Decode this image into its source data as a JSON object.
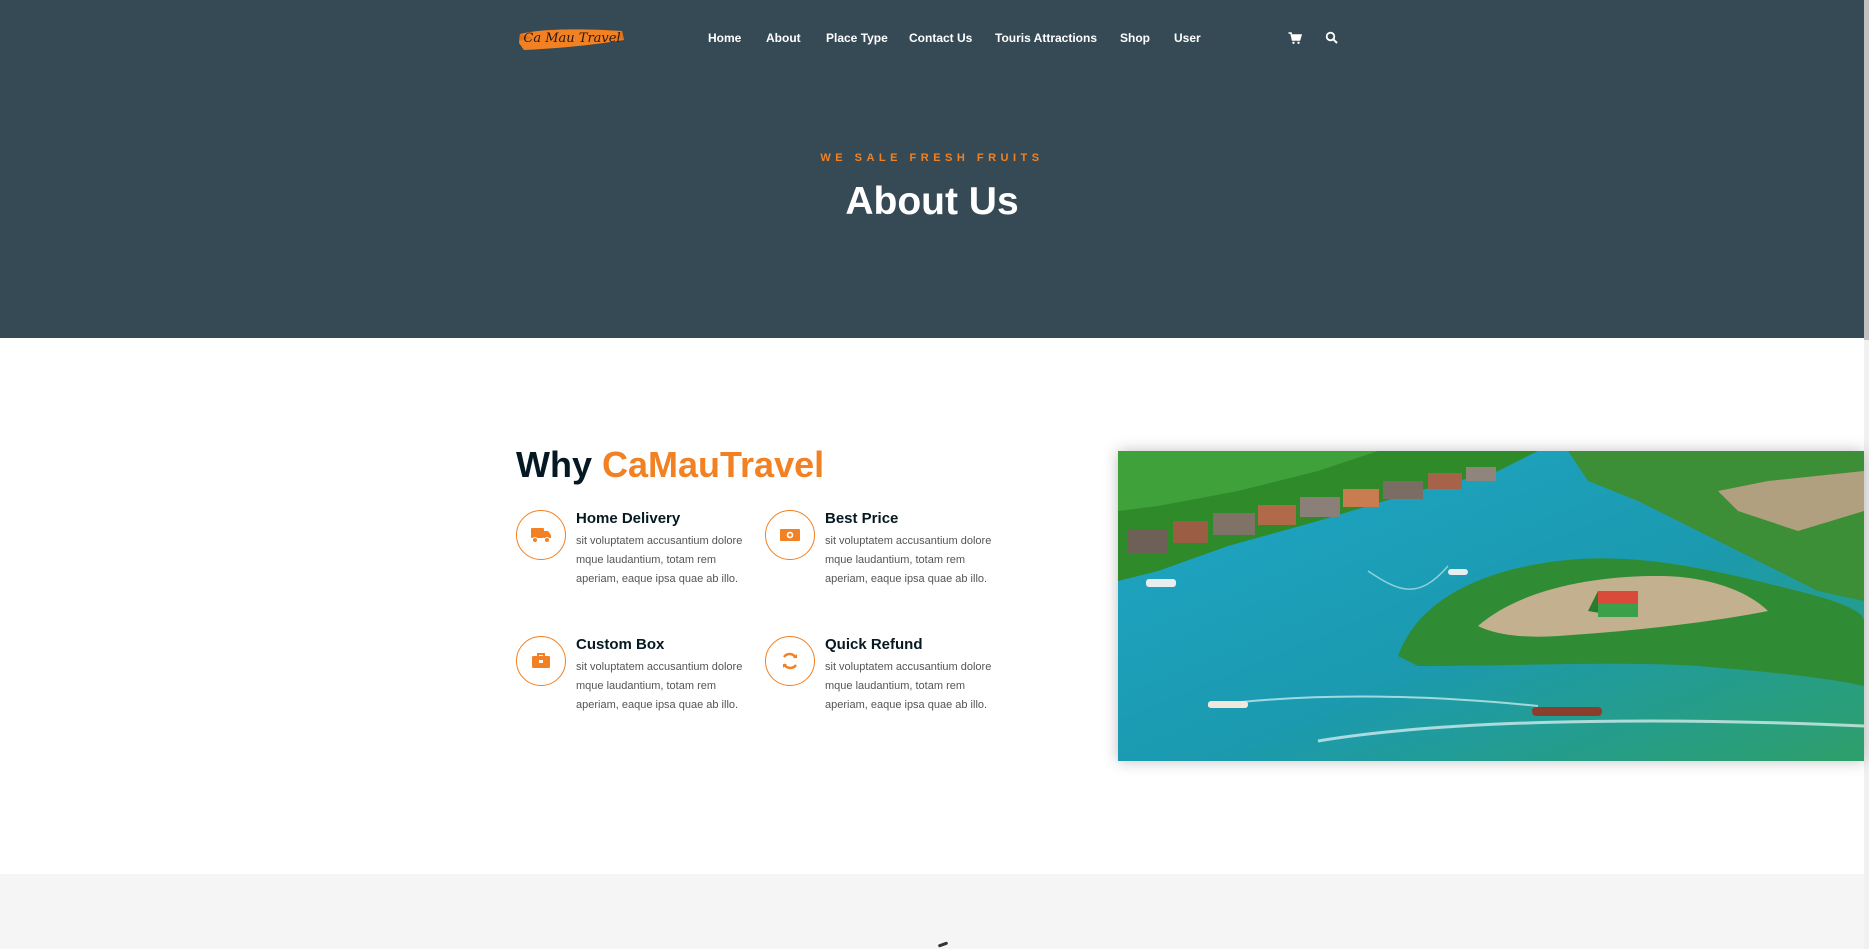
{
  "brand": {
    "logo_text": "Ca Mau Travel",
    "accent": "#f28123",
    "hero_bg": "#364a55"
  },
  "nav": {
    "items": [
      "Home",
      "About",
      "Place Type",
      "Contact Us",
      "Touris Attractions",
      "Shop",
      "User"
    ],
    "cart_icon": "cart-icon",
    "search_icon": "search-icon"
  },
  "hero": {
    "eyebrow": "WE SALE FRESH FRUITS",
    "title": "About Us"
  },
  "why": {
    "title_prefix": "Why",
    "title_accent": "CaMauTravel",
    "features": [
      {
        "icon": "truck-icon",
        "title": "Home Delivery",
        "desc": "sit voluptatem accusantium dolore mque laudantium, totam rem aperiam, eaque ipsa quae ab illo."
      },
      {
        "icon": "money-icon",
        "title": "Best Price",
        "desc": "sit voluptatem accusantium dolore mque laudantium, totam rem aperiam, eaque ipsa quae ab illo."
      },
      {
        "icon": "briefcase-icon",
        "title": "Custom Box",
        "desc": "sit voluptatem accusantium dolore mque laudantium, totam rem aperiam, eaque ipsa quae ab illo."
      },
      {
        "icon": "refresh-icon",
        "title": "Quick Refund",
        "desc": "sit voluptatem accusantium dolore mque laudantium, totam rem aperiam, eaque ipsa quae ab illo."
      }
    ]
  },
  "photo": {
    "subject": "aerial-river-village-photo"
  }
}
